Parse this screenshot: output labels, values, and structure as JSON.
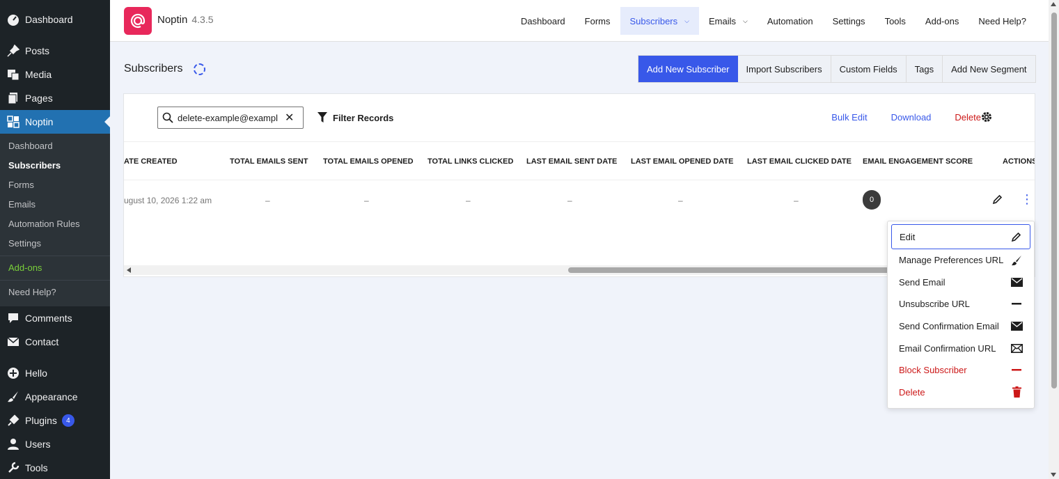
{
  "sidebar": {
    "top_items": [
      {
        "label": "Dashboard",
        "icon": "dashboard-icon"
      },
      {
        "label": "Posts",
        "icon": "pin-icon"
      },
      {
        "label": "Media",
        "icon": "media-icon"
      },
      {
        "label": "Pages",
        "icon": "pages-icon"
      },
      {
        "label": "Noptin",
        "icon": "noptin-icon"
      }
    ],
    "sub_items": [
      "Dashboard",
      "Subscribers",
      "Forms",
      "Emails",
      "Automation Rules",
      "Settings"
    ],
    "addons_label": "Add-ons",
    "help_label": "Need Help?",
    "bottom_items": [
      {
        "label": "Comments",
        "icon": "comment-icon"
      },
      {
        "label": "Contact",
        "icon": "mail-icon"
      },
      {
        "label": "Hello",
        "icon": "plus-circle-icon"
      },
      {
        "label": "Appearance",
        "icon": "brush-icon"
      },
      {
        "label": "Plugins",
        "icon": "plug-icon"
      },
      {
        "label": "Users",
        "icon": "user-icon"
      },
      {
        "label": "Tools",
        "icon": "wrench-icon"
      }
    ],
    "plugins_badge": "4"
  },
  "topbar": {
    "brand": "Noptin",
    "version": "4.3.5",
    "nav": [
      "Dashboard",
      "Forms",
      "Subscribers",
      "Emails",
      "Automation",
      "Settings",
      "Tools",
      "Add-ons",
      "Need Help?"
    ]
  },
  "header": {
    "title": "Subscribers",
    "buttons": [
      "Add New Subscriber",
      "Import Subscribers",
      "Custom Fields",
      "Tags",
      "Add New Segment"
    ]
  },
  "toolbar": {
    "search_value": "delete-example@exampl",
    "filter_label": "Filter Records",
    "bulk_edit": "Bulk Edit",
    "download": "Download",
    "delete": "Delete"
  },
  "table": {
    "columns": [
      "ATE CREATED",
      "TOTAL EMAILS SENT",
      "TOTAL EMAILS OPENED",
      "TOTAL LINKS CLICKED",
      "LAST EMAIL SENT DATE",
      "LAST EMAIL OPENED DATE",
      "LAST EMAIL CLICKED DATE",
      "EMAIL ENGAGEMENT SCORE",
      "ACTIONS"
    ],
    "row": {
      "date_created": "ugust 10, 2026 1:22 am",
      "emails_sent": "–",
      "emails_opened": "–",
      "links_clicked": "–",
      "last_sent": "–",
      "last_opened": "–",
      "last_clicked": "–",
      "score": "0"
    }
  },
  "menu": {
    "items": [
      {
        "label": "Edit",
        "icon": "pencil-icon"
      },
      {
        "label": "Manage Preferences URL",
        "icon": "brush-icon"
      },
      {
        "label": "Send Email",
        "icon": "envelope-icon"
      },
      {
        "label": "Unsubscribe URL",
        "icon": "minus-icon"
      },
      {
        "label": "Send Confirmation Email",
        "icon": "envelope-icon"
      },
      {
        "label": "Email Confirmation URL",
        "icon": "envelope-outline-icon"
      },
      {
        "label": "Block Subscriber",
        "icon": "minus-icon"
      },
      {
        "label": "Delete",
        "icon": "trash-icon"
      }
    ]
  },
  "colors": {
    "accent": "#3858e9",
    "danger": "#cc1818",
    "sidebar_bg": "#1d2327",
    "sidebar_active": "#2271b1",
    "brand": "#e8285b",
    "addons_green": "#7ad03a"
  }
}
